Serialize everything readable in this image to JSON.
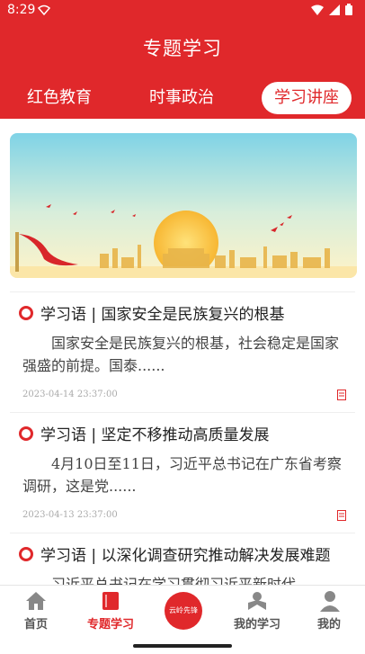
{
  "status": {
    "time": "8:29"
  },
  "header": {
    "title": "专题学习",
    "tabs": [
      {
        "label": "红色教育"
      },
      {
        "label": "时事政治"
      },
      {
        "label": "学习讲座"
      }
    ]
  },
  "articles": [
    {
      "title": "学习语 | 国家安全是民族复兴的根基",
      "summary": "国家安全是民族复兴的根基，社会稳定是国家强盛的前提。国泰......",
      "date": "2023-04-14 23:37:00"
    },
    {
      "title": "学习语 | 坚定不移推动高质量发展",
      "summary": "4月10日至11日，习近平总书记在广东省考察调研，这是党......",
      "date": "2023-04-13 23:37:00"
    },
    {
      "title": "学习语 | 以深化调查研究推动解决发展难题",
      "summary": "习近平总书记在学习贯彻习近平新时代"
    }
  ],
  "nav": {
    "items": [
      {
        "label": "首页"
      },
      {
        "label": "专题学习"
      },
      {
        "label": "我的学习"
      },
      {
        "label": "我的"
      }
    ],
    "center_label": "云岭先锋"
  },
  "colors": {
    "primary": "#e0282b"
  }
}
